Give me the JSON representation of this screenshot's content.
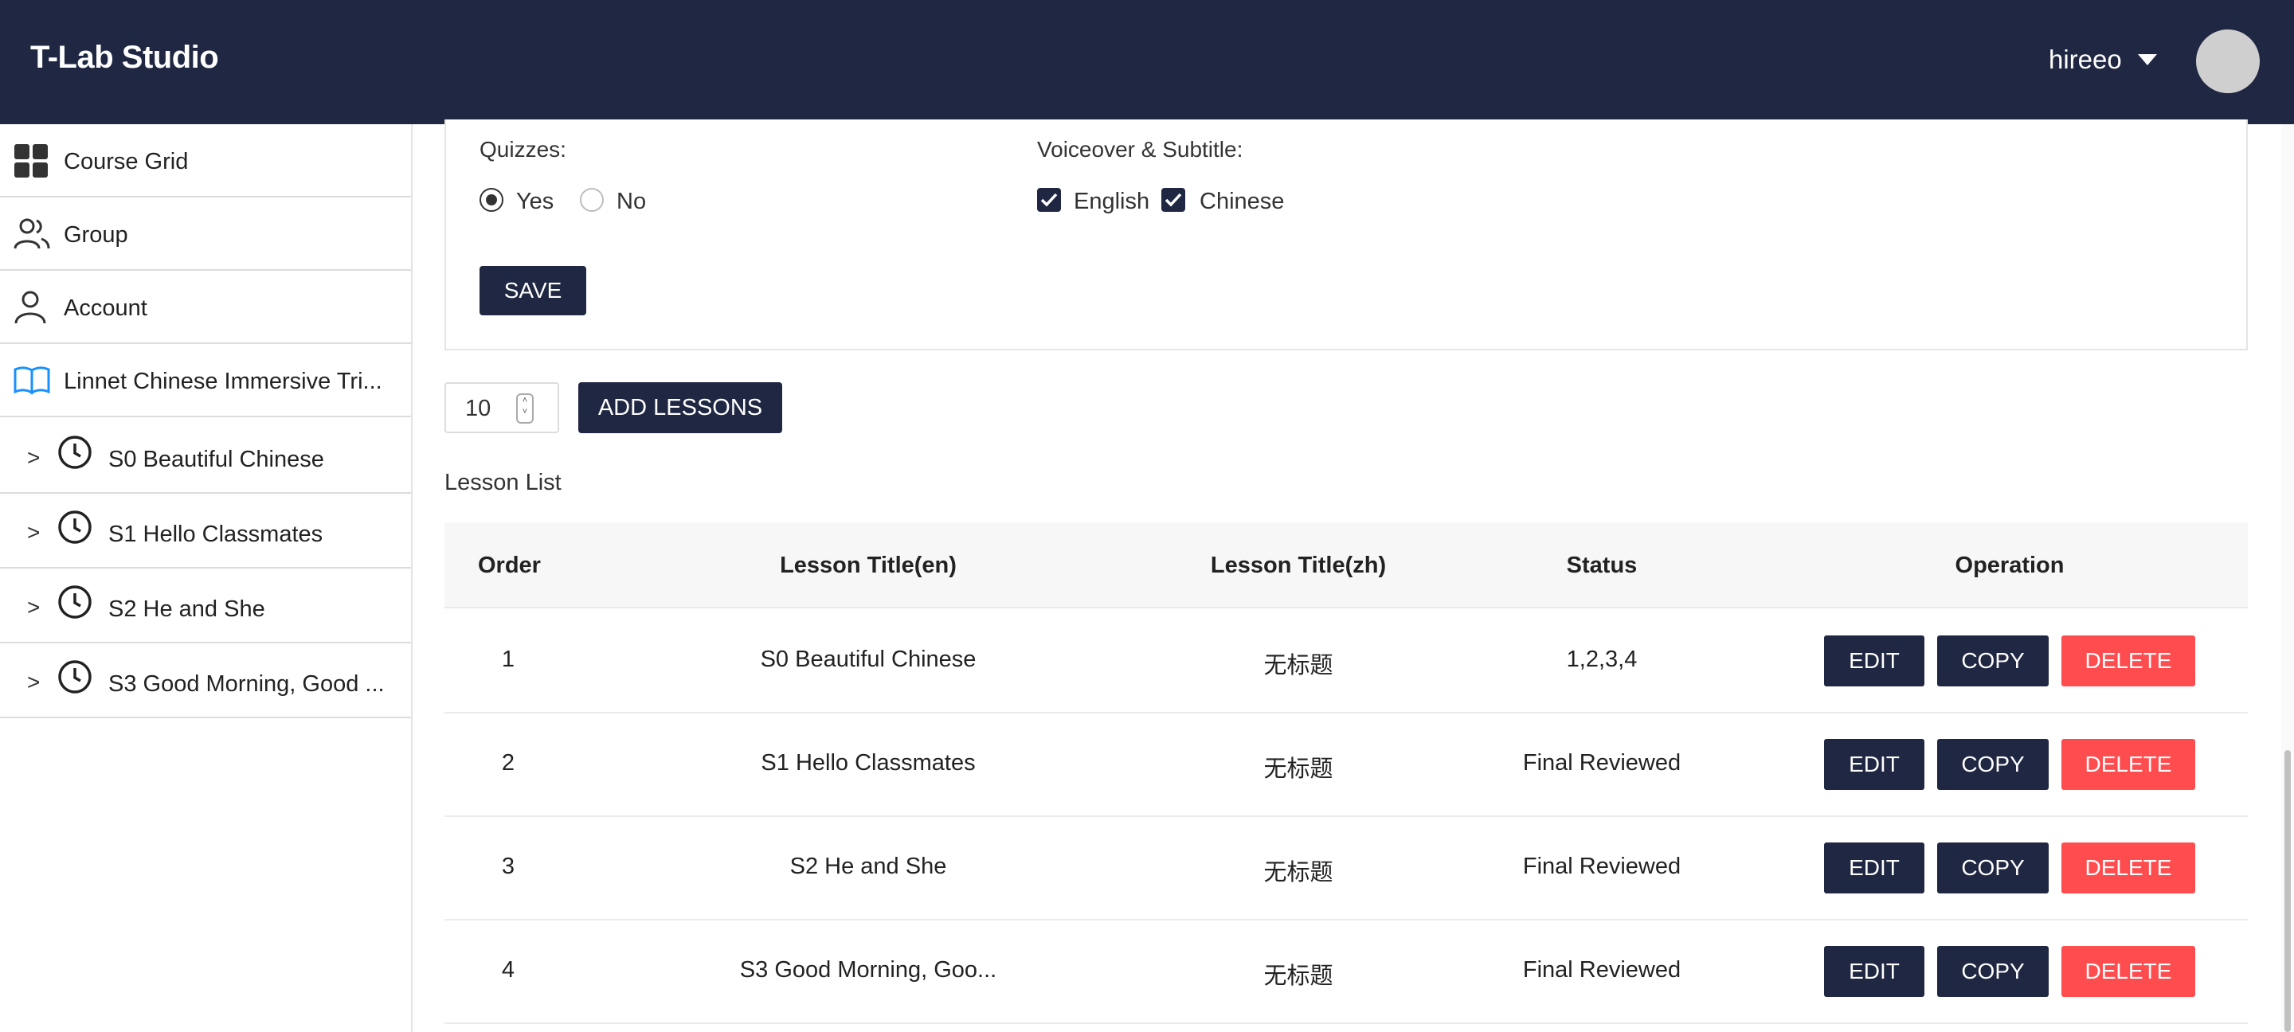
{
  "header": {
    "brand": "T-Lab Studio",
    "username": "hireeo"
  },
  "sidebar": {
    "items": [
      {
        "label": "Course Grid",
        "icon": "grid-icon"
      },
      {
        "label": "Group",
        "icon": "group-icon"
      },
      {
        "label": "Account",
        "icon": "person-icon"
      },
      {
        "label": "Linnet Chinese Immersive Tri...",
        "icon": "book-icon"
      }
    ],
    "sub_items": [
      {
        "label": "S0 Beautiful Chinese",
        "icon": "clock-icon"
      },
      {
        "label": "S1 Hello Classmates",
        "icon": "clock-icon"
      },
      {
        "label": "S2 He and She",
        "icon": "clock-icon"
      },
      {
        "label": "S3 Good Morning, Good ...",
        "icon": "clock-icon"
      }
    ]
  },
  "settings": {
    "quizzes_label": "Quizzes:",
    "quizzes_options": [
      {
        "label": "Yes",
        "selected": true
      },
      {
        "label": "No",
        "selected": false
      }
    ],
    "voiceover_label": "Voiceover & Subtitle:",
    "voiceover_options": [
      {
        "label": "English",
        "checked": true
      },
      {
        "label": "Chinese",
        "checked": true
      }
    ],
    "save_label": "SAVE"
  },
  "lesson_count": {
    "value": "10",
    "add_label": "ADD LESSONS"
  },
  "lesson_list": {
    "title": "Lesson List",
    "columns": [
      "Order",
      "Lesson Title(en)",
      "Lesson Title(zh)",
      "Status",
      "Operation"
    ],
    "rows": [
      {
        "order": "1",
        "title_en": "S0 Beautiful Chinese",
        "title_zh": "无标题",
        "status": "1,2,3,4"
      },
      {
        "order": "2",
        "title_en": "S1 Hello Classmates",
        "title_zh": "无标题",
        "status": "Final Reviewed"
      },
      {
        "order": "3",
        "title_en": "S2 He and She",
        "title_zh": "无标题",
        "status": "Final Reviewed"
      },
      {
        "order": "4",
        "title_en": "S3 Good Morning, Goo...",
        "title_zh": "无标题",
        "status": "Final Reviewed"
      }
    ],
    "operations": {
      "edit": "EDIT",
      "copy": "COPY",
      "delete": "DELETE"
    }
  },
  "colors": {
    "header_bg": "#1f2742",
    "primary_button": "#1f2742",
    "danger_button": "#ff4d4f"
  }
}
